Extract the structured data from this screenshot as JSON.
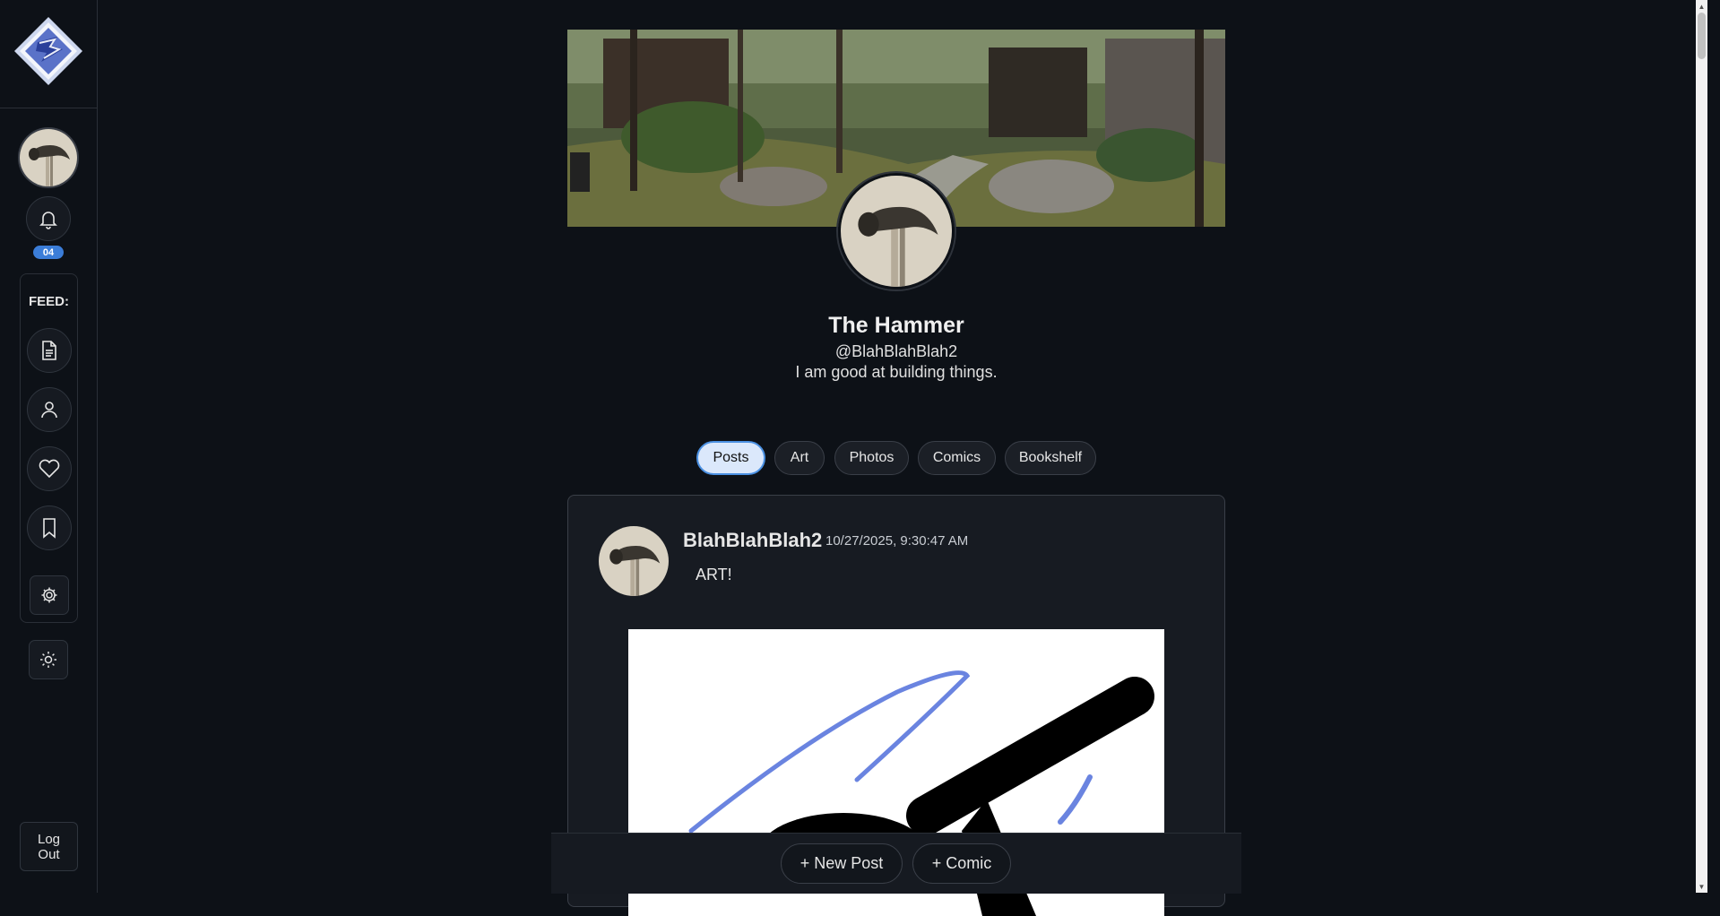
{
  "sidebar": {
    "notification_count": "04",
    "feed_label": "FEED:",
    "feed_items": [
      {
        "icon": "document-icon"
      },
      {
        "icon": "user-icon"
      },
      {
        "icon": "heart-icon"
      },
      {
        "icon": "bookmark-icon"
      },
      {
        "icon": "gear-icon"
      }
    ],
    "theme_toggle_icon": "sun-icon",
    "logout_line1": "Log",
    "logout_line2": "Out"
  },
  "profile": {
    "name": "The Hammer",
    "handle": "@BlahBlahBlah2",
    "bio": "I am good at building things."
  },
  "tabs": [
    {
      "label": "Posts",
      "active": true
    },
    {
      "label": "Art",
      "active": false
    },
    {
      "label": "Photos",
      "active": false
    },
    {
      "label": "Comics",
      "active": false
    },
    {
      "label": "Bookshelf",
      "active": false
    }
  ],
  "post": {
    "username": "BlahBlahBlah2",
    "timestamp": "10/27/2025, 9:30:47 AM",
    "text": "ART!"
  },
  "bottom_bar": {
    "new_post_label": "+ New Post",
    "comic_label": "+ Comic"
  },
  "colors": {
    "background": "#0d1117",
    "accent": "#4a90e2",
    "badge": "#3b7dd8"
  }
}
